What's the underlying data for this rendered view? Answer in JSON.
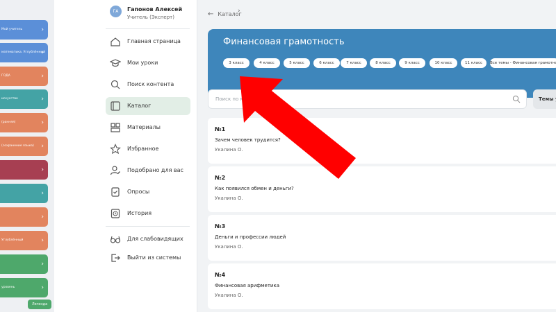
{
  "left_strip": {
    "bars": [
      {
        "text": "Мой учитель",
        "color": "#5b8fd8"
      },
      {
        "text": "математика. Углублённый",
        "color": "#5b8fd8"
      },
      {
        "text": "ГОДА",
        "color": "#e2845e"
      },
      {
        "text": "искусство",
        "color": "#44a3a5"
      },
      {
        "text": "(ранняя)",
        "color": "#e2845e"
      },
      {
        "text": "(сохранение языка)",
        "color": "#e2845e"
      },
      {
        "text": "",
        "color": "#a73f52"
      },
      {
        "text": "",
        "color": "#44a3a5"
      },
      {
        "text": "",
        "color": "#e2845e"
      },
      {
        "text": "Углублённый",
        "color": "#e2845e"
      },
      {
        "text": "",
        "color": "#4ea86b"
      },
      {
        "text": "уровень",
        "color": "#4ea86b"
      }
    ],
    "legend": "Легенда"
  },
  "profile": {
    "initials": "ГА",
    "name": "Гапонов Алексей",
    "role": "Учитель (Эксперт)"
  },
  "nav": [
    {
      "label": "Главная страница",
      "icon": "home-icon"
    },
    {
      "label": "Мои уроки",
      "icon": "graduation-cap-icon"
    },
    {
      "label": "Поиск контента",
      "icon": "search-icon"
    },
    {
      "label": "Каталог",
      "icon": "catalog-icon",
      "active": true
    },
    {
      "label": "Материалы",
      "icon": "materials-icon"
    },
    {
      "label": "Избранное",
      "icon": "star-icon"
    },
    {
      "label": "Подобрано для вас",
      "icon": "user-heart-icon"
    },
    {
      "label": "Опросы",
      "icon": "survey-icon"
    },
    {
      "label": "История",
      "icon": "history-icon"
    }
  ],
  "nav_bottom": [
    {
      "label": "Для слабовидящих",
      "icon": "glasses-icon"
    },
    {
      "label": "Выйти из системы",
      "icon": "logout-icon"
    }
  ],
  "breadcrumb": {
    "back_label": "Каталог"
  },
  "banner": {
    "title": "Финансовая грамотность",
    "chips": [
      "3 класс",
      "4 класс",
      "5 класс",
      "6 класс",
      "7 класс",
      "8 класс",
      "9 класс",
      "10 класс",
      "11 класс",
      "Все темы - Финансовая грамотность"
    ]
  },
  "search": {
    "placeholder": "Поиск по материалам",
    "topics_label": "Темы уроков"
  },
  "lessons": [
    {
      "num": "№1",
      "title": "Зачем человек трудится?",
      "author": "Укалина О."
    },
    {
      "num": "№2",
      "title": "Как появился обмен и деньги?",
      "author": "Укалина О."
    },
    {
      "num": "№3",
      "title": "Деньги и профессии людей",
      "author": "Укалина О."
    },
    {
      "num": "№4",
      "title": "Финансовая арифметика",
      "author": "Укалина О."
    }
  ],
  "colors": {
    "banner": "#3e86bb",
    "active_nav": "#e2eee6",
    "annotation_arrow": "#ff0000"
  }
}
